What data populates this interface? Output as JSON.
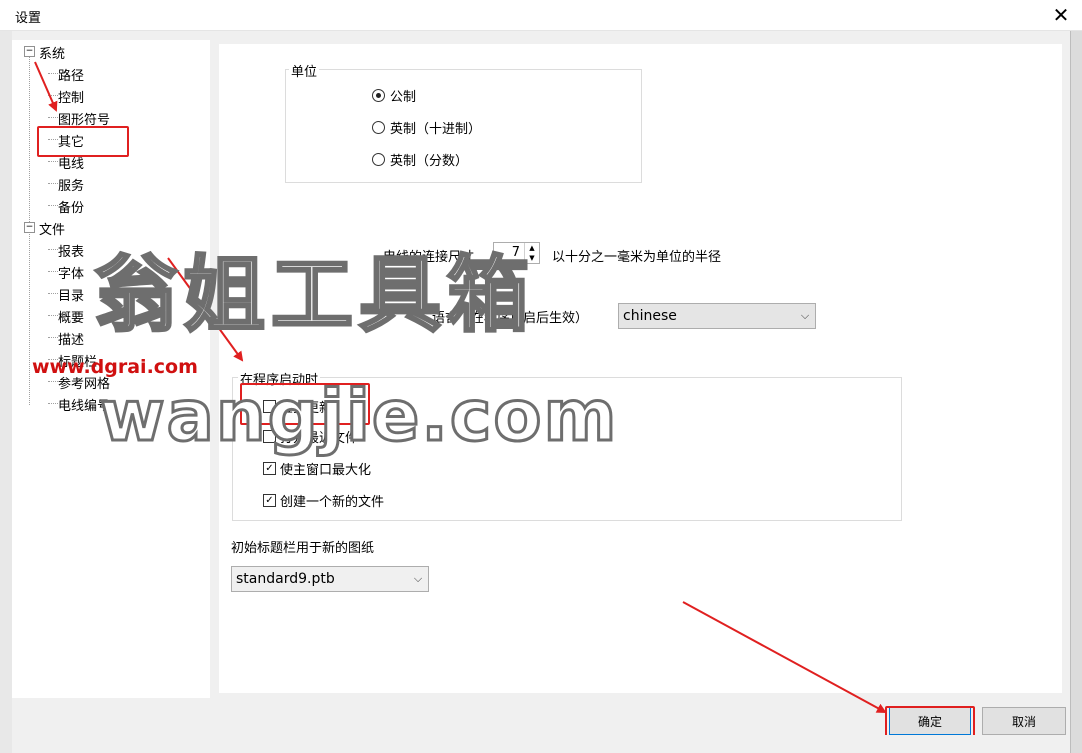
{
  "window": {
    "title": "设置",
    "close_glyph": "✕"
  },
  "tree": {
    "groups": [
      {
        "label": "系统",
        "expander": "−",
        "children": [
          "路径",
          "控制",
          "图形符号",
          "其它",
          "电线",
          "服务",
          "备份"
        ]
      },
      {
        "label": "文件",
        "expander": "−",
        "children": [
          "报表",
          "字体",
          "目录",
          "概要",
          "描述",
          "标题栏",
          "参考网格",
          "电线编号"
        ]
      }
    ]
  },
  "units": {
    "legend": "单位",
    "options": [
      {
        "label": "公制",
        "selected": true
      },
      {
        "label": "英制（十进制）",
        "selected": false
      },
      {
        "label": "英制（分数）",
        "selected": false
      }
    ]
  },
  "wire": {
    "prefix": "电线的连接尺寸",
    "value": "7",
    "suffix": "以十分之一毫米为单位的半径",
    "up": "▲",
    "down": "▼"
  },
  "language": {
    "label": "语言（在程序重启后生效）",
    "value": "chinese",
    "arrow": "⌵"
  },
  "startup": {
    "legend": "在程序启动时",
    "options": [
      {
        "label": "检查更新",
        "checked": false
      },
      {
        "label": "打开最近文件",
        "checked": false
      },
      {
        "label": "使主窗口最大化",
        "checked": true
      },
      {
        "label": "创建一个新的文件",
        "checked": true
      }
    ]
  },
  "titleblock": {
    "label": "初始标题栏用于新的图纸",
    "value": "standard9.ptb",
    "arrow": "⌵"
  },
  "buttons": {
    "ok": "确定",
    "cancel": "取消"
  },
  "watermarks": {
    "url": "www.dgrai.com",
    "big_cn": "翁姐工具箱",
    "big_en": "wangjie.com"
  },
  "colors": {
    "annotation": "#e02020",
    "accent": "#0078d7"
  }
}
